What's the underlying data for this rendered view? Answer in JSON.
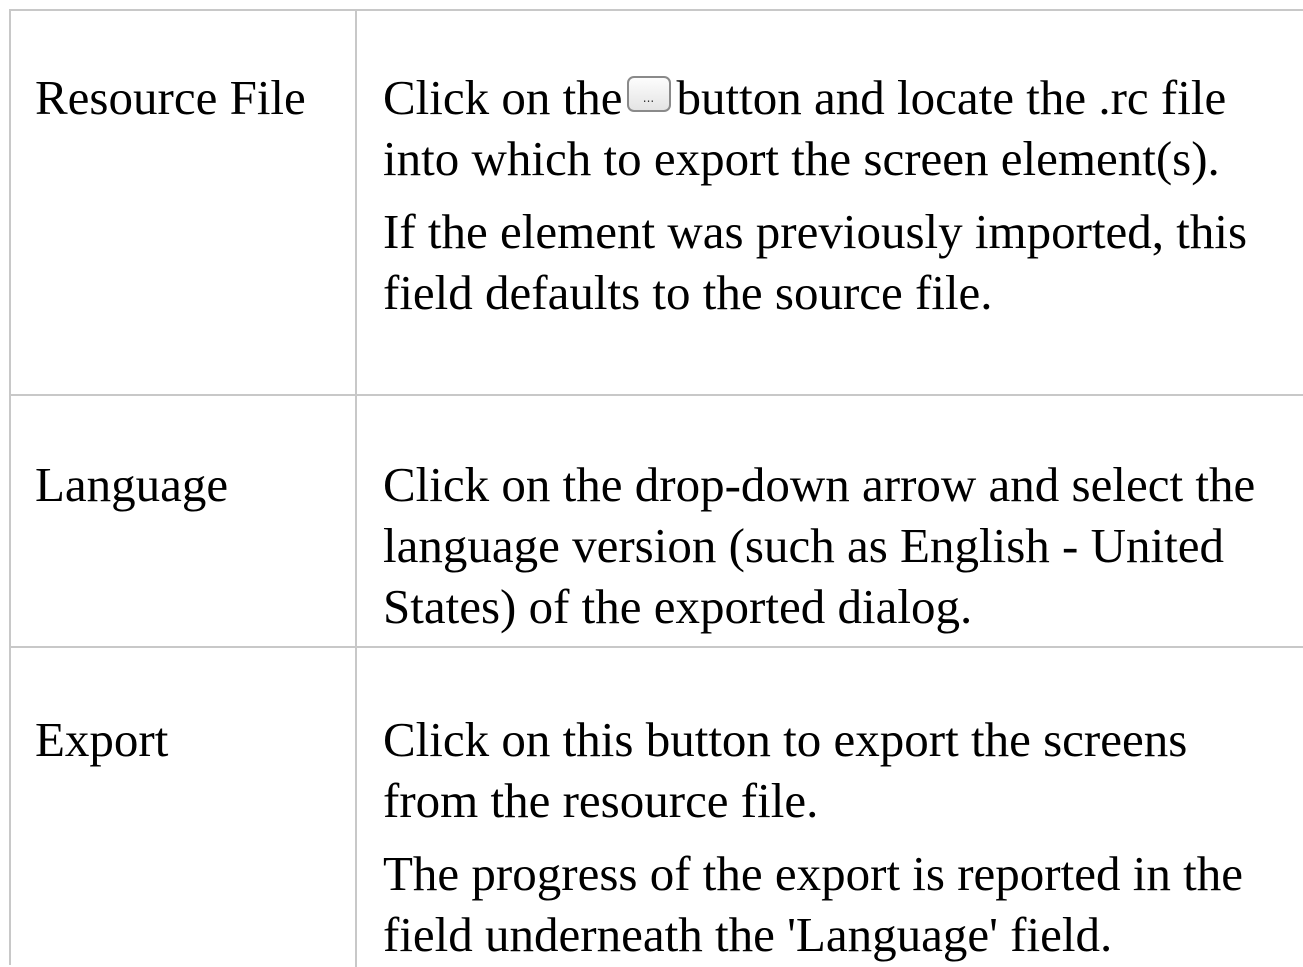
{
  "rows": [
    {
      "term": "Resource File",
      "desc": {
        "before_icon": "Click on the",
        "icon_glyph": "...",
        "after_icon": "button and locate the .rc file into which to export the screen element(s).",
        "para2": "If the element was previously imported, this field defaults to the source file."
      }
    },
    {
      "term": "Language",
      "desc": {
        "para1": "Click on the drop-down arrow and select the language version (such as English - United States) of the exported dialog."
      }
    },
    {
      "term": "Export",
      "desc": {
        "para1": "Click on this button to export the screens from the resource file.",
        "para2": "The progress of the export is reported in the field underneath the 'Language' field."
      }
    }
  ],
  "icons": {
    "browse_button": "ellipsis-button-icon"
  },
  "colors": {
    "border": "#c8c8c8",
    "text": "#000000",
    "background": "#ffffff"
  }
}
